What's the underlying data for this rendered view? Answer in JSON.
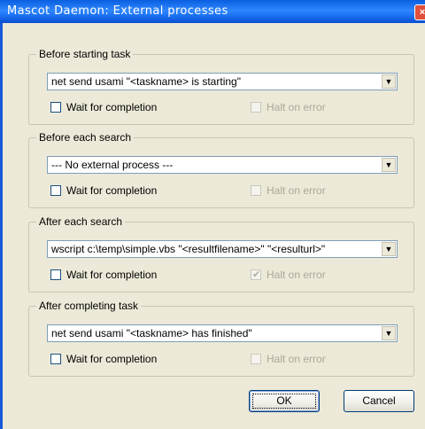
{
  "window": {
    "title": "Mascot Daemon: External processes",
    "close_label": "×"
  },
  "groups": [
    {
      "label": "Before starting task",
      "command": "net send usami \"<taskname> is starting\"",
      "wait_label": "Wait for completion",
      "halt_label": "Halt on error",
      "halt_checked": false
    },
    {
      "label": "Before each search",
      "command": "--- No external process ---",
      "wait_label": "Wait for completion",
      "halt_label": "Halt on error",
      "halt_checked": false
    },
    {
      "label": "After each search",
      "command": "wscript c:\\temp\\simple.vbs \"<resultfilename>\" \"<resulturl>\"",
      "wait_label": "Wait for completion",
      "halt_label": "Halt on error",
      "halt_checked": true
    },
    {
      "label": "After completing task",
      "command": "net send usami \"<taskname> has finished\"",
      "wait_label": "Wait for completion",
      "halt_label": "Halt on error",
      "halt_checked": false
    }
  ],
  "buttons": {
    "ok": "OK",
    "cancel": "Cancel"
  },
  "icons": {
    "dropdown": "chevron-down-icon",
    "close": "close-icon"
  },
  "colors": {
    "titlebar": "#0a5fe0",
    "dialog_bg": "#ece9d8",
    "disabled_text": "#aca899"
  }
}
